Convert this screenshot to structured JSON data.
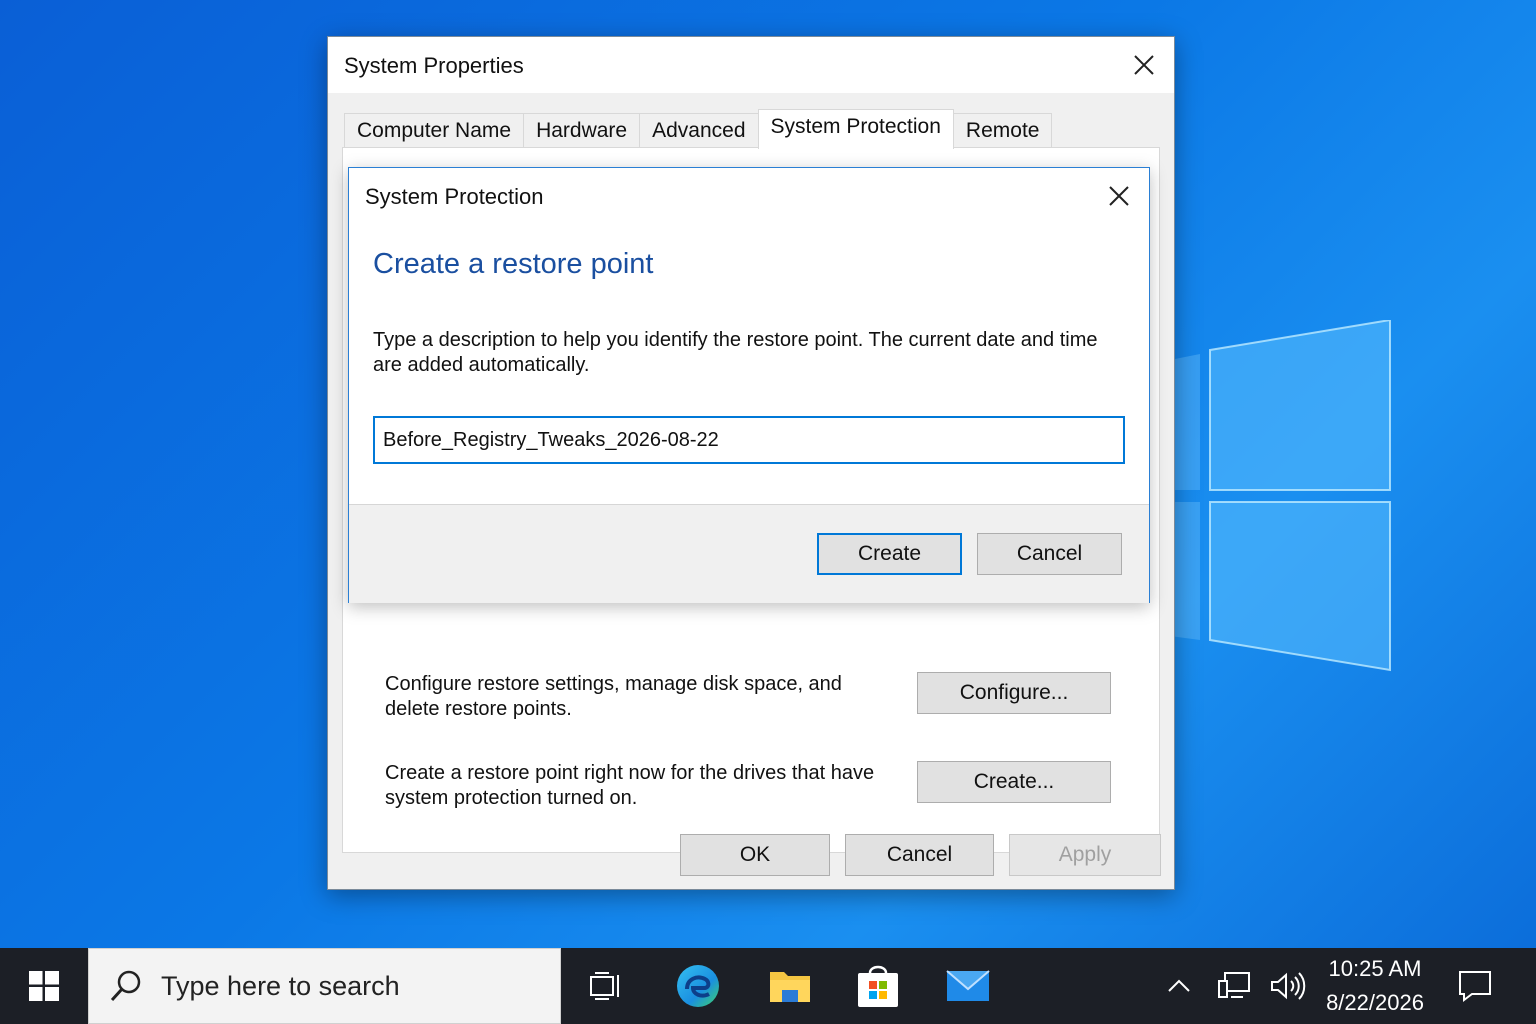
{
  "system_properties": {
    "title": "System Properties",
    "tabs": [
      {
        "label": "Computer Name"
      },
      {
        "label": "Hardware"
      },
      {
        "label": "Advanced"
      },
      {
        "label": "System Protection",
        "active": true
      },
      {
        "label": "Remote"
      }
    ],
    "configure_desc": "Configure restore settings, manage disk space, and delete restore points.",
    "configure_button": "Configure...",
    "create_desc": "Create a restore point right now for the drives that have system protection turned on.",
    "create_button": "Create...",
    "ok_button": "OK",
    "cancel_button": "Cancel",
    "apply_button": "Apply"
  },
  "dialog": {
    "title": "System Protection",
    "heading": "Create a restore point",
    "description": "Type a description to help you identify the restore point. The current date and time are added automatically.",
    "input_value": "Before_Registry_Tweaks_2026-08-22",
    "create_button": "Create",
    "cancel_button": "Cancel"
  },
  "taskbar": {
    "search_placeholder": "Type here to search",
    "time": "10:25 AM",
    "date": "8/22/2026",
    "pinned": [
      "task-view-icon",
      "edge-icon",
      "file-explorer-icon",
      "store-icon",
      "mail-icon"
    ],
    "tray": [
      "chevron-up-icon",
      "network-icon",
      "volume-icon",
      "notification-icon"
    ]
  },
  "colors": {
    "accent": "#0078d7",
    "heading_blue": "#1a4fa0",
    "taskbar": "#1c1f26",
    "desktop": "#0b78e6"
  }
}
